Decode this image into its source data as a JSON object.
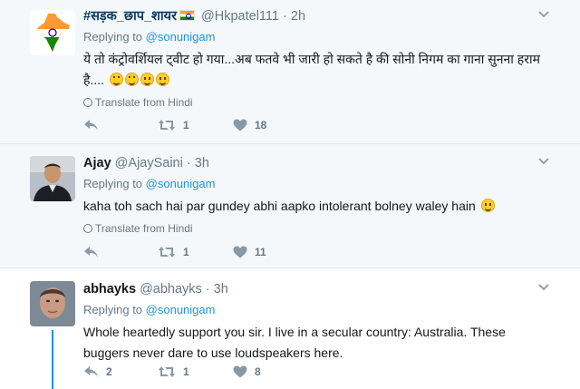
{
  "tweets": [
    {
      "fullname": "#सड़क_छाप_शायर",
      "screenname": "@Hkpatel111",
      "time": "2h",
      "reply_prefix": "Replying to",
      "reply_mention": "@sonunigam",
      "text": "ये तो कंट्रोवर्शियल ट्वीट हो गया...अब फतवे भी जारी हो सकते है की सोनी निगम का गाना सुनना हराम है....",
      "translate": "Translate from Hindi",
      "replies": "",
      "retweets": "1",
      "likes": "18"
    },
    {
      "fullname": "Ajay",
      "screenname": "@AjaySaini",
      "time": "3h",
      "reply_prefix": "Replying to",
      "reply_mention": "@sonunigam",
      "text": "kaha toh sach hai par gundey abhi aapko intolerant bolney waley hain",
      "translate": "Translate from Hindi",
      "replies": "",
      "retweets": "1",
      "likes": "11"
    },
    {
      "fullname": "abhayks",
      "screenname": "@abhayks",
      "time": "3h",
      "reply_prefix": "Replying to",
      "reply_mention": "@sonunigam",
      "text": "Whole heartedly support you sir. I live in a secular country: Australia. These buggers never dare to use loudspeakers here.",
      "translate": "",
      "replies": "2",
      "retweets": "1",
      "likes": "8"
    }
  ],
  "separator": "·",
  "colors": {
    "link_blue": "#1b95e0",
    "muted_gray": "#657786",
    "hover_bg": "#f5f8fa"
  },
  "icons": {
    "reply": "reply-arrow",
    "retweet": "retweet-arrows",
    "like": "heart",
    "more": "chevron-down",
    "translate": "globe"
  }
}
